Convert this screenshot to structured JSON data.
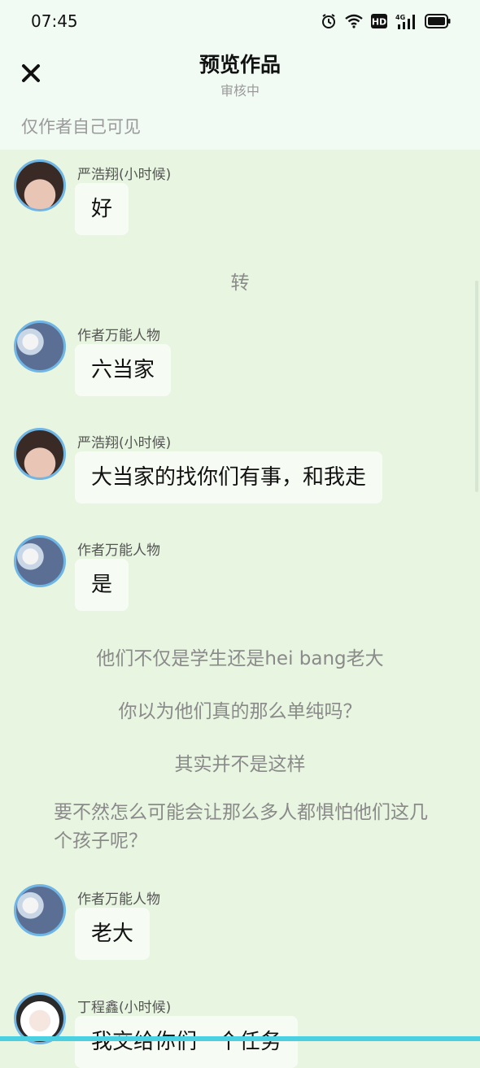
{
  "status": {
    "time": "07:45",
    "icons": [
      "alarm-icon",
      "wifi-icon",
      "hd-icon",
      "signal-4g-icon",
      "battery-icon"
    ]
  },
  "header": {
    "close_icon": "close-icon",
    "title": "预览作品",
    "subtitle": "审核中",
    "visibility": "仅作者自己可见"
  },
  "messages": [
    {
      "sender": "严浩翔(小时候)",
      "text": "好"
    },
    {
      "narration": "转"
    },
    {
      "sender": "作者万能人物",
      "text": "六当家"
    },
    {
      "sender": "严浩翔(小时候)",
      "text": "大当家的找你们有事，和我走"
    },
    {
      "sender": "作者万能人物",
      "text": "是"
    },
    {
      "narration": "他们不仅是学生还是hei bang老大"
    },
    {
      "narration": "你以为他们真的那么单纯吗？"
    },
    {
      "narration": "其实并不是这样"
    },
    {
      "narration": "要不然怎么可能会让那么多人都惧怕他们这几个孩子呢？"
    },
    {
      "sender": "作者万能人物",
      "text": "老大"
    },
    {
      "sender": "丁程鑫(小时候)",
      "text": "我交给你们一个任务"
    }
  ],
  "colors": {
    "background": "#e8f5e0",
    "header_bg": "#f1fbf4",
    "bubble": "#f6fcf4",
    "avatar_border": "#6fb6e6"
  }
}
